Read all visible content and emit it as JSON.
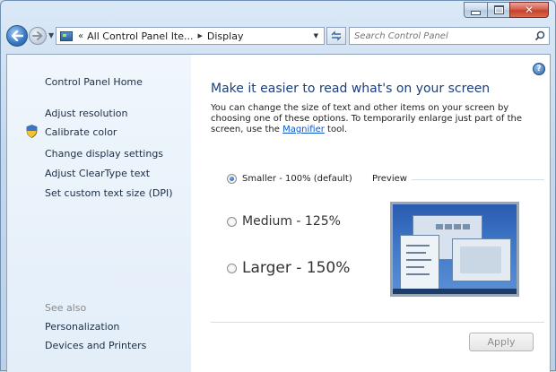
{
  "window": {
    "accent": "#bcd1e8",
    "close_color": "#c7402c"
  },
  "nav": {
    "breadcrumb_prefix": "«",
    "breadcrumb_parent": "All Control Panel Ite...",
    "breadcrumb_current": "Display",
    "search_placeholder": "Search Control Panel"
  },
  "sidebar": {
    "home": "Control Panel Home",
    "links": [
      "Adjust resolution",
      "Calibrate color",
      "Change display settings",
      "Adjust ClearType text",
      "Set custom text size (DPI)"
    ],
    "see_also_title": "See also",
    "see_also": [
      "Personalization",
      "Devices and Printers"
    ]
  },
  "main": {
    "heading": "Make it easier to read what's on your screen",
    "desc_before": "You can change the size of text and other items on your screen by choosing one of these options. To temporarily enlarge just part of the screen, use the ",
    "desc_link": "Magnifier",
    "desc_after": " tool.",
    "options": [
      {
        "label": "Smaller - 100% (default)",
        "checked": true
      },
      {
        "label": "Medium - 125%",
        "checked": false
      },
      {
        "label": "Larger - 150%",
        "checked": false
      }
    ],
    "preview_label": "Preview",
    "apply_label": "Apply"
  },
  "icons": [
    "back-arrow-icon",
    "forward-arrow-icon",
    "control-panel-icon",
    "refresh-icon",
    "search-icon",
    "shield-icon",
    "help-icon"
  ]
}
